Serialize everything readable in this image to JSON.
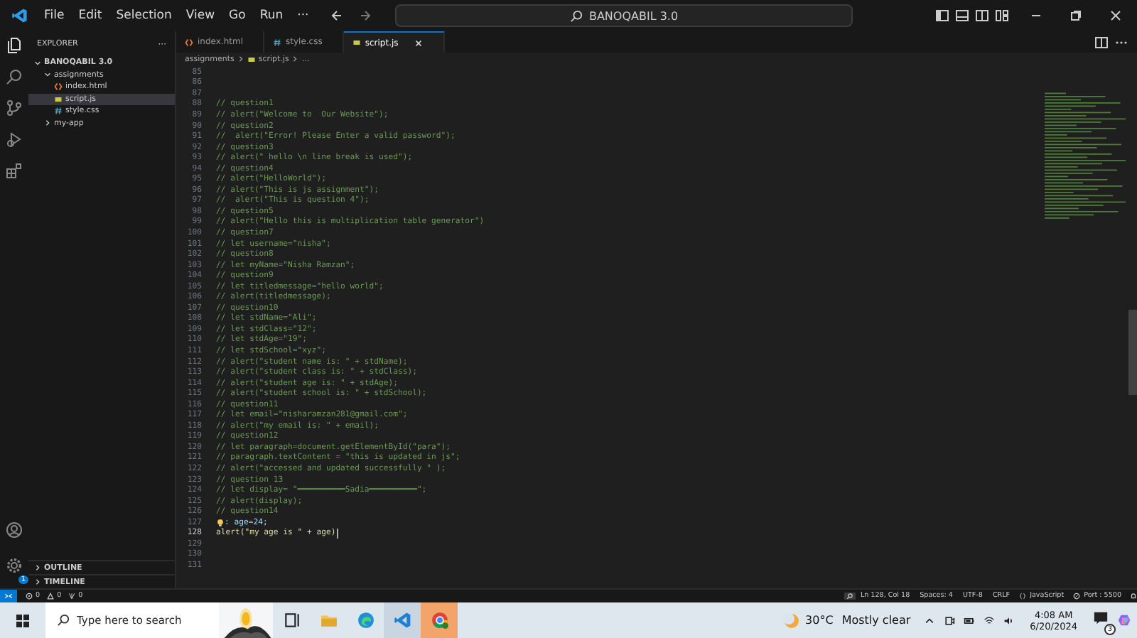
{
  "menu": [
    "File",
    "Edit",
    "Selection",
    "View",
    "Go",
    "Run",
    "···"
  ],
  "window": {
    "title": "BANOQABIL 3.0"
  },
  "sidebar": {
    "title": "EXPLORER",
    "more": "···",
    "tree": [
      {
        "label": "BANOQABIL 3.0",
        "kind": "root",
        "expanded": true,
        "selected": false,
        "children": [
          {
            "label": "assignments",
            "kind": "folder",
            "expanded": true,
            "selected": false,
            "children": [
              {
                "label": "index.html",
                "kind": "html",
                "selected": false
              },
              {
                "label": "script.js",
                "kind": "js",
                "selected": true
              },
              {
                "label": "style.css",
                "kind": "css",
                "selected": false
              }
            ]
          },
          {
            "label": "my-app",
            "kind": "folder",
            "expanded": false,
            "selected": false
          }
        ]
      }
    ],
    "sections": [
      {
        "label": "OUTLINE",
        "expanded": false
      },
      {
        "label": "TIMELINE",
        "expanded": false
      }
    ],
    "settings_badge": "1"
  },
  "tabs": [
    {
      "label": "index.html",
      "kind": "html",
      "selected": false
    },
    {
      "label": "style.css",
      "kind": "css",
      "selected": false
    },
    {
      "label": "script.js",
      "kind": "js",
      "selected": true
    }
  ],
  "breadcrumb": [
    {
      "label": "assignments",
      "kind": "folder"
    },
    {
      "label": "script.js",
      "kind": "js"
    },
    {
      "label": "…",
      "kind": "more"
    }
  ],
  "code": [
    {
      "num": "85",
      "kind": "blank"
    },
    {
      "num": "86",
      "kind": "blank"
    },
    {
      "num": "87",
      "kind": "blank"
    },
    {
      "num": "88",
      "kind": "comment",
      "text": "// question1"
    },
    {
      "num": "89",
      "kind": "comment",
      "text": "// alert(\"Welcome to  Our Website\");"
    },
    {
      "num": "90",
      "kind": "comment",
      "text": "// question2"
    },
    {
      "num": "91",
      "kind": "comment",
      "text": "//  alert(\"Error! Please Enter a valid password\");"
    },
    {
      "num": "92",
      "kind": "comment",
      "text": "// question3"
    },
    {
      "num": "93",
      "kind": "comment",
      "text": "// alert(\" hello \\n line break is used\");"
    },
    {
      "num": "94",
      "kind": "comment",
      "text": "// question4"
    },
    {
      "num": "95",
      "kind": "comment",
      "text": "// alert(\"HelloWorld\");"
    },
    {
      "num": "96",
      "kind": "comment",
      "text": "// alert(\"This is js assignment\");"
    },
    {
      "num": "97",
      "kind": "comment",
      "text": "//  alert(\"This is question 4\");"
    },
    {
      "num": "98",
      "kind": "comment",
      "text": "// question5"
    },
    {
      "num": "99",
      "kind": "comment",
      "text": "// alert(\"Hello this is multiplication table generator\")"
    },
    {
      "num": "100",
      "kind": "comment",
      "text": "// question7"
    },
    {
      "num": "101",
      "kind": "comment",
      "text": "// let username=\"nisha\";"
    },
    {
      "num": "102",
      "kind": "comment",
      "text": "// question8"
    },
    {
      "num": "103",
      "kind": "comment",
      "text": "// let myName=\"Nisha Ramzan\";"
    },
    {
      "num": "104",
      "kind": "comment",
      "text": "// question9"
    },
    {
      "num": "105",
      "kind": "comment",
      "text": "// let titledmessage=\"hello world\";"
    },
    {
      "num": "106",
      "kind": "comment",
      "text": "// alert(titledmessage);"
    },
    {
      "num": "107",
      "kind": "comment",
      "text": "// question10"
    },
    {
      "num": "108",
      "kind": "comment",
      "text": "// let stdName=\"Ali\";"
    },
    {
      "num": "109",
      "kind": "comment",
      "text": "// let stdClass=\"12\";"
    },
    {
      "num": "110",
      "kind": "comment",
      "text": "// let stdAge=\"19\";"
    },
    {
      "num": "111",
      "kind": "comment",
      "text": "// let stdSchool=\"xyz\";"
    },
    {
      "num": "112",
      "kind": "comment",
      "text": "// alert(\"student name is: \" + stdName);"
    },
    {
      "num": "113",
      "kind": "comment",
      "text": "// alert(\"student class is: \" + stdClass);"
    },
    {
      "num": "114",
      "kind": "comment",
      "text": "// alert(\"student age is: \" + stdAge);"
    },
    {
      "num": "115",
      "kind": "comment",
      "text": "// alert(\"student school is: \" + stdSchool);"
    },
    {
      "num": "116",
      "kind": "comment",
      "text": "// question11"
    },
    {
      "num": "117",
      "kind": "comment",
      "text": "// let email=\"nisharamzan281@gmail.com\";"
    },
    {
      "num": "118",
      "kind": "comment",
      "text": "// alert(\"my email is: \" + email);"
    },
    {
      "num": "119",
      "kind": "comment",
      "text": "// question12"
    },
    {
      "num": "120",
      "kind": "comment",
      "text": "// let paragraph=document.getElementById(\"para\");"
    },
    {
      "num": "121",
      "kind": "comment",
      "text": "// paragraph.textContent = \"this is updated in js\";"
    },
    {
      "num": "122",
      "kind": "comment",
      "text": "// alert(\"accessed and updated successfully \" );"
    },
    {
      "num": "123",
      "kind": "comment",
      "text": "// question 13"
    },
    {
      "num": "124",
      "kind": "comment",
      "text": "// let display= \"━━━━━━━━━━Sadia━━━━━━━━━━\";"
    },
    {
      "num": "125",
      "kind": "comment",
      "text": "// alert(display);"
    },
    {
      "num": "126",
      "kind": "comment",
      "text": "// question14"
    },
    {
      "num": "127",
      "kind": "bulb",
      "text": ": age=24;"
    },
    {
      "num": "128",
      "kind": "current",
      "text": "alert(\"my age is \" + age)"
    },
    {
      "num": "129",
      "kind": "blank"
    },
    {
      "num": "130",
      "kind": "blank"
    },
    {
      "num": "131",
      "kind": "blank"
    }
  ],
  "status": {
    "errors": "0",
    "warnings": "0",
    "ports": "0",
    "right": [
      {
        "label": "Ln 128, Col 18",
        "kind": "text"
      },
      {
        "label": "Spaces: 4",
        "kind": "text"
      },
      {
        "label": "UTF-8",
        "kind": "text"
      },
      {
        "label": "CRLF",
        "kind": "text"
      },
      {
        "label": "JavaScript",
        "kind": "braces"
      },
      {
        "label": "Port : 5500",
        "kind": "port"
      }
    ]
  },
  "taskbar": {
    "search": {
      "placeholder": "Type here to search"
    },
    "apps": [
      {
        "kind": "taskview",
        "selected": false
      },
      {
        "kind": "folder",
        "selected": false
      },
      {
        "kind": "edge",
        "selected": false
      },
      {
        "kind": "vscode",
        "selected": true
      },
      {
        "kind": "chrome",
        "selected": true
      }
    ],
    "temperature": "30°C",
    "weather": "Mostly clear",
    "time": "4:08 AM",
    "date": "6/20/2024",
    "notifications": "3"
  }
}
